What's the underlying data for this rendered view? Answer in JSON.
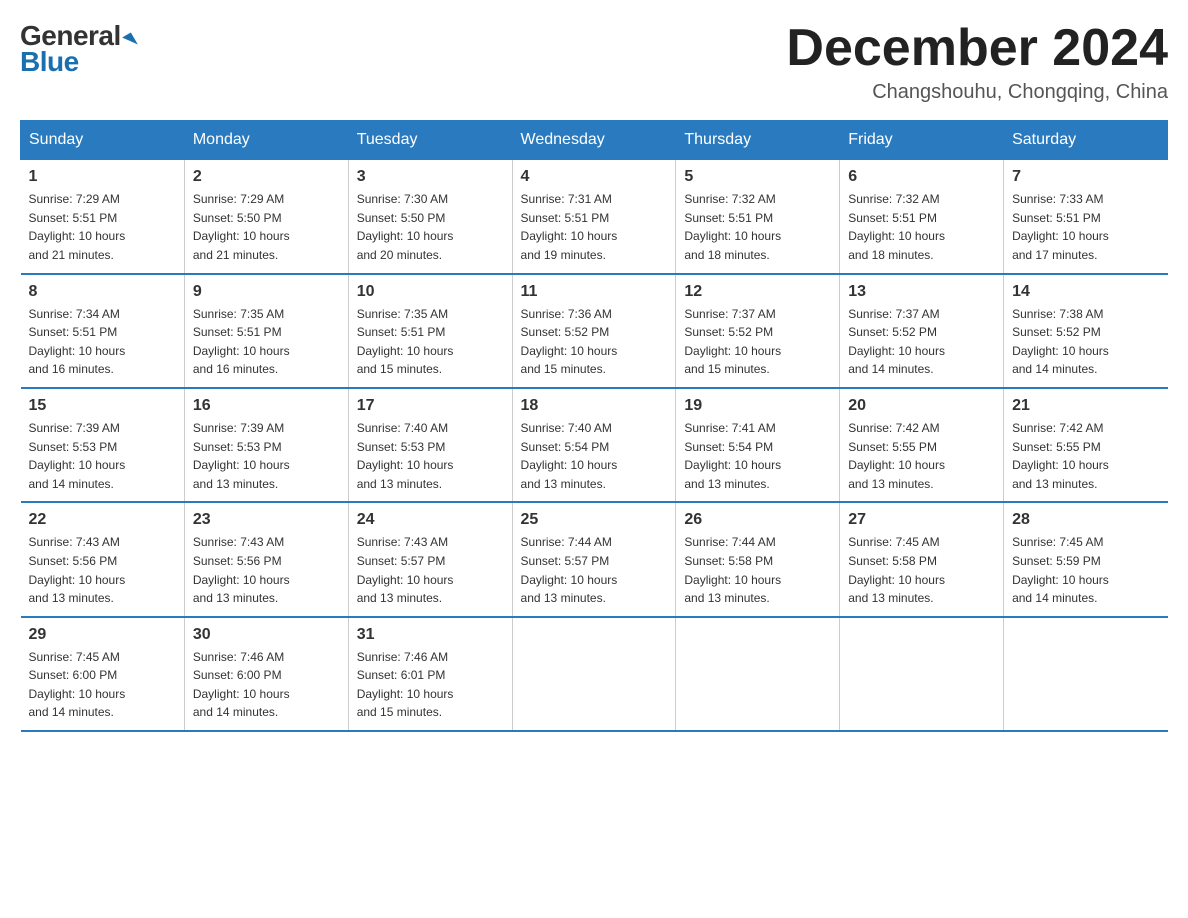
{
  "logo": {
    "general": "General",
    "blue": "Blue"
  },
  "header": {
    "month_year": "December 2024",
    "location": "Changshouhu, Chongqing, China"
  },
  "days_of_week": [
    "Sunday",
    "Monday",
    "Tuesday",
    "Wednesday",
    "Thursday",
    "Friday",
    "Saturday"
  ],
  "weeks": [
    [
      {
        "num": "1",
        "sunrise": "7:29 AM",
        "sunset": "5:51 PM",
        "daylight": "10 hours and 21 minutes."
      },
      {
        "num": "2",
        "sunrise": "7:29 AM",
        "sunset": "5:50 PM",
        "daylight": "10 hours and 21 minutes."
      },
      {
        "num": "3",
        "sunrise": "7:30 AM",
        "sunset": "5:50 PM",
        "daylight": "10 hours and 20 minutes."
      },
      {
        "num": "4",
        "sunrise": "7:31 AM",
        "sunset": "5:51 PM",
        "daylight": "10 hours and 19 minutes."
      },
      {
        "num": "5",
        "sunrise": "7:32 AM",
        "sunset": "5:51 PM",
        "daylight": "10 hours and 18 minutes."
      },
      {
        "num": "6",
        "sunrise": "7:32 AM",
        "sunset": "5:51 PM",
        "daylight": "10 hours and 18 minutes."
      },
      {
        "num": "7",
        "sunrise": "7:33 AM",
        "sunset": "5:51 PM",
        "daylight": "10 hours and 17 minutes."
      }
    ],
    [
      {
        "num": "8",
        "sunrise": "7:34 AM",
        "sunset": "5:51 PM",
        "daylight": "10 hours and 16 minutes."
      },
      {
        "num": "9",
        "sunrise": "7:35 AM",
        "sunset": "5:51 PM",
        "daylight": "10 hours and 16 minutes."
      },
      {
        "num": "10",
        "sunrise": "7:35 AM",
        "sunset": "5:51 PM",
        "daylight": "10 hours and 15 minutes."
      },
      {
        "num": "11",
        "sunrise": "7:36 AM",
        "sunset": "5:52 PM",
        "daylight": "10 hours and 15 minutes."
      },
      {
        "num": "12",
        "sunrise": "7:37 AM",
        "sunset": "5:52 PM",
        "daylight": "10 hours and 15 minutes."
      },
      {
        "num": "13",
        "sunrise": "7:37 AM",
        "sunset": "5:52 PM",
        "daylight": "10 hours and 14 minutes."
      },
      {
        "num": "14",
        "sunrise": "7:38 AM",
        "sunset": "5:52 PM",
        "daylight": "10 hours and 14 minutes."
      }
    ],
    [
      {
        "num": "15",
        "sunrise": "7:39 AM",
        "sunset": "5:53 PM",
        "daylight": "10 hours and 14 minutes."
      },
      {
        "num": "16",
        "sunrise": "7:39 AM",
        "sunset": "5:53 PM",
        "daylight": "10 hours and 13 minutes."
      },
      {
        "num": "17",
        "sunrise": "7:40 AM",
        "sunset": "5:53 PM",
        "daylight": "10 hours and 13 minutes."
      },
      {
        "num": "18",
        "sunrise": "7:40 AM",
        "sunset": "5:54 PM",
        "daylight": "10 hours and 13 minutes."
      },
      {
        "num": "19",
        "sunrise": "7:41 AM",
        "sunset": "5:54 PM",
        "daylight": "10 hours and 13 minutes."
      },
      {
        "num": "20",
        "sunrise": "7:42 AM",
        "sunset": "5:55 PM",
        "daylight": "10 hours and 13 minutes."
      },
      {
        "num": "21",
        "sunrise": "7:42 AM",
        "sunset": "5:55 PM",
        "daylight": "10 hours and 13 minutes."
      }
    ],
    [
      {
        "num": "22",
        "sunrise": "7:43 AM",
        "sunset": "5:56 PM",
        "daylight": "10 hours and 13 minutes."
      },
      {
        "num": "23",
        "sunrise": "7:43 AM",
        "sunset": "5:56 PM",
        "daylight": "10 hours and 13 minutes."
      },
      {
        "num": "24",
        "sunrise": "7:43 AM",
        "sunset": "5:57 PM",
        "daylight": "10 hours and 13 minutes."
      },
      {
        "num": "25",
        "sunrise": "7:44 AM",
        "sunset": "5:57 PM",
        "daylight": "10 hours and 13 minutes."
      },
      {
        "num": "26",
        "sunrise": "7:44 AM",
        "sunset": "5:58 PM",
        "daylight": "10 hours and 13 minutes."
      },
      {
        "num": "27",
        "sunrise": "7:45 AM",
        "sunset": "5:58 PM",
        "daylight": "10 hours and 13 minutes."
      },
      {
        "num": "28",
        "sunrise": "7:45 AM",
        "sunset": "5:59 PM",
        "daylight": "10 hours and 14 minutes."
      }
    ],
    [
      {
        "num": "29",
        "sunrise": "7:45 AM",
        "sunset": "6:00 PM",
        "daylight": "10 hours and 14 minutes."
      },
      {
        "num": "30",
        "sunrise": "7:46 AM",
        "sunset": "6:00 PM",
        "daylight": "10 hours and 14 minutes."
      },
      {
        "num": "31",
        "sunrise": "7:46 AM",
        "sunset": "6:01 PM",
        "daylight": "10 hours and 15 minutes."
      },
      null,
      null,
      null,
      null
    ]
  ],
  "labels": {
    "sunrise": "Sunrise:",
    "sunset": "Sunset:",
    "daylight": "Daylight:"
  }
}
